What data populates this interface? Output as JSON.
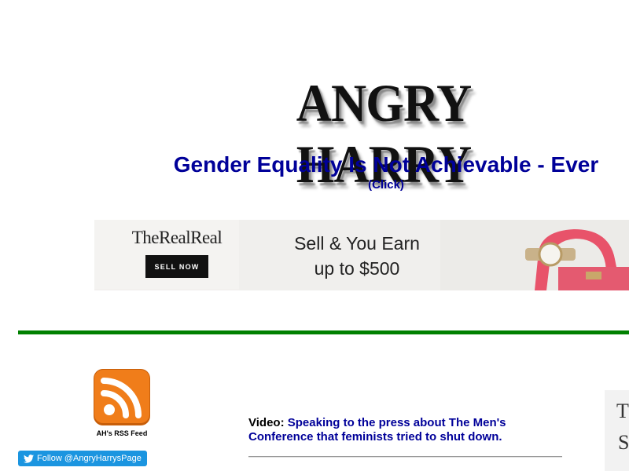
{
  "header": {
    "logo_text": "ANGRY HARRY",
    "headline": "Gender Equality Is Not Achievable - Ever",
    "click_label": "(Click)"
  },
  "ad": {
    "brand": "TheRealReal",
    "button_label": "SELL NOW",
    "tagline_line1": "Sell & You Earn",
    "tagline_line2": "up to $500"
  },
  "colors": {
    "link_blue": "#000099",
    "divider_green": "#008000",
    "twitter_blue": "#1b95e0",
    "rss_orange": "#f07d1a"
  },
  "sidebar": {
    "rss_icon": "rss-feed-icon",
    "rss_label": "AH's RSS Feed",
    "follow_label": "Follow @AngryHarrysPage",
    "follow_icon": "twitter-bird-icon"
  },
  "main": {
    "video_prefix": "Video:",
    "video_link": "Speaking to the press about The Men's Conference that feminists tried to shut down."
  },
  "side_panel": {
    "letter1": "T",
    "letter2": "S"
  }
}
